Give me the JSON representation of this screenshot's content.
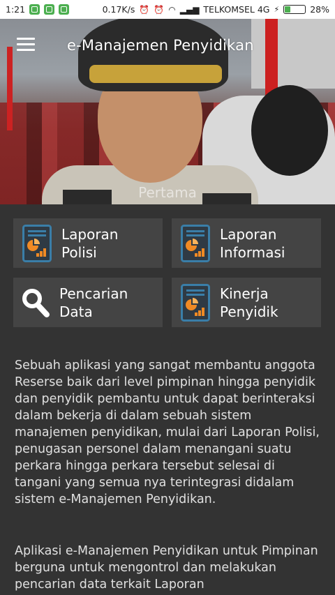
{
  "status_bar": {
    "time": "1:21",
    "speed": "0.17K/s",
    "carrier": "TELKOMSEL 4G",
    "battery": "28%",
    "battery_level": 0.28
  },
  "header": {
    "title": "e-Manajemen Penyidikan",
    "menu_icon": "hamburger-menu-icon",
    "banner_caption": "Pertama"
  },
  "menu": {
    "laporan_polisi": {
      "line1": "Laporan",
      "line2": "Polisi",
      "icon": "report-chart-icon"
    },
    "laporan_informasi": {
      "line1": "Laporan",
      "line2": "Informasi",
      "icon": "report-chart-icon"
    },
    "pencarian_data": {
      "line1": "Pencarian",
      "line2": "Data",
      "icon": "search-icon"
    },
    "kinerja_penyidik": {
      "line1": "Kinerja",
      "line2": "Penyidik",
      "icon": "report-chart-icon"
    }
  },
  "description": {
    "p1": "Sebuah aplikasi yang sangat membantu anggota Reserse baik dari level pimpinan hingga penyidik dan penyidik pembantu untuk dapat berinteraksi dalam bekerja di dalam sebuah sistem manajemen penyidikan, mulai dari Laporan Polisi, penugasan personel dalam menangani suatu perkara hingga perkara tersebut selesai di tangani yang semua nya terintegrasi didalam sistem e-Manajemen Penyidikan.",
    "p2": "Aplikasi e-Manajemen Penyidikan untuk Pimpinan berguna untuk mengontrol dan melakukan pencarian data terkait Laporan"
  },
  "colors": {
    "background": "#333333",
    "tile": "#444444",
    "icon_frame": "#3a7ea8",
    "icon_chart": "#f08a24"
  }
}
